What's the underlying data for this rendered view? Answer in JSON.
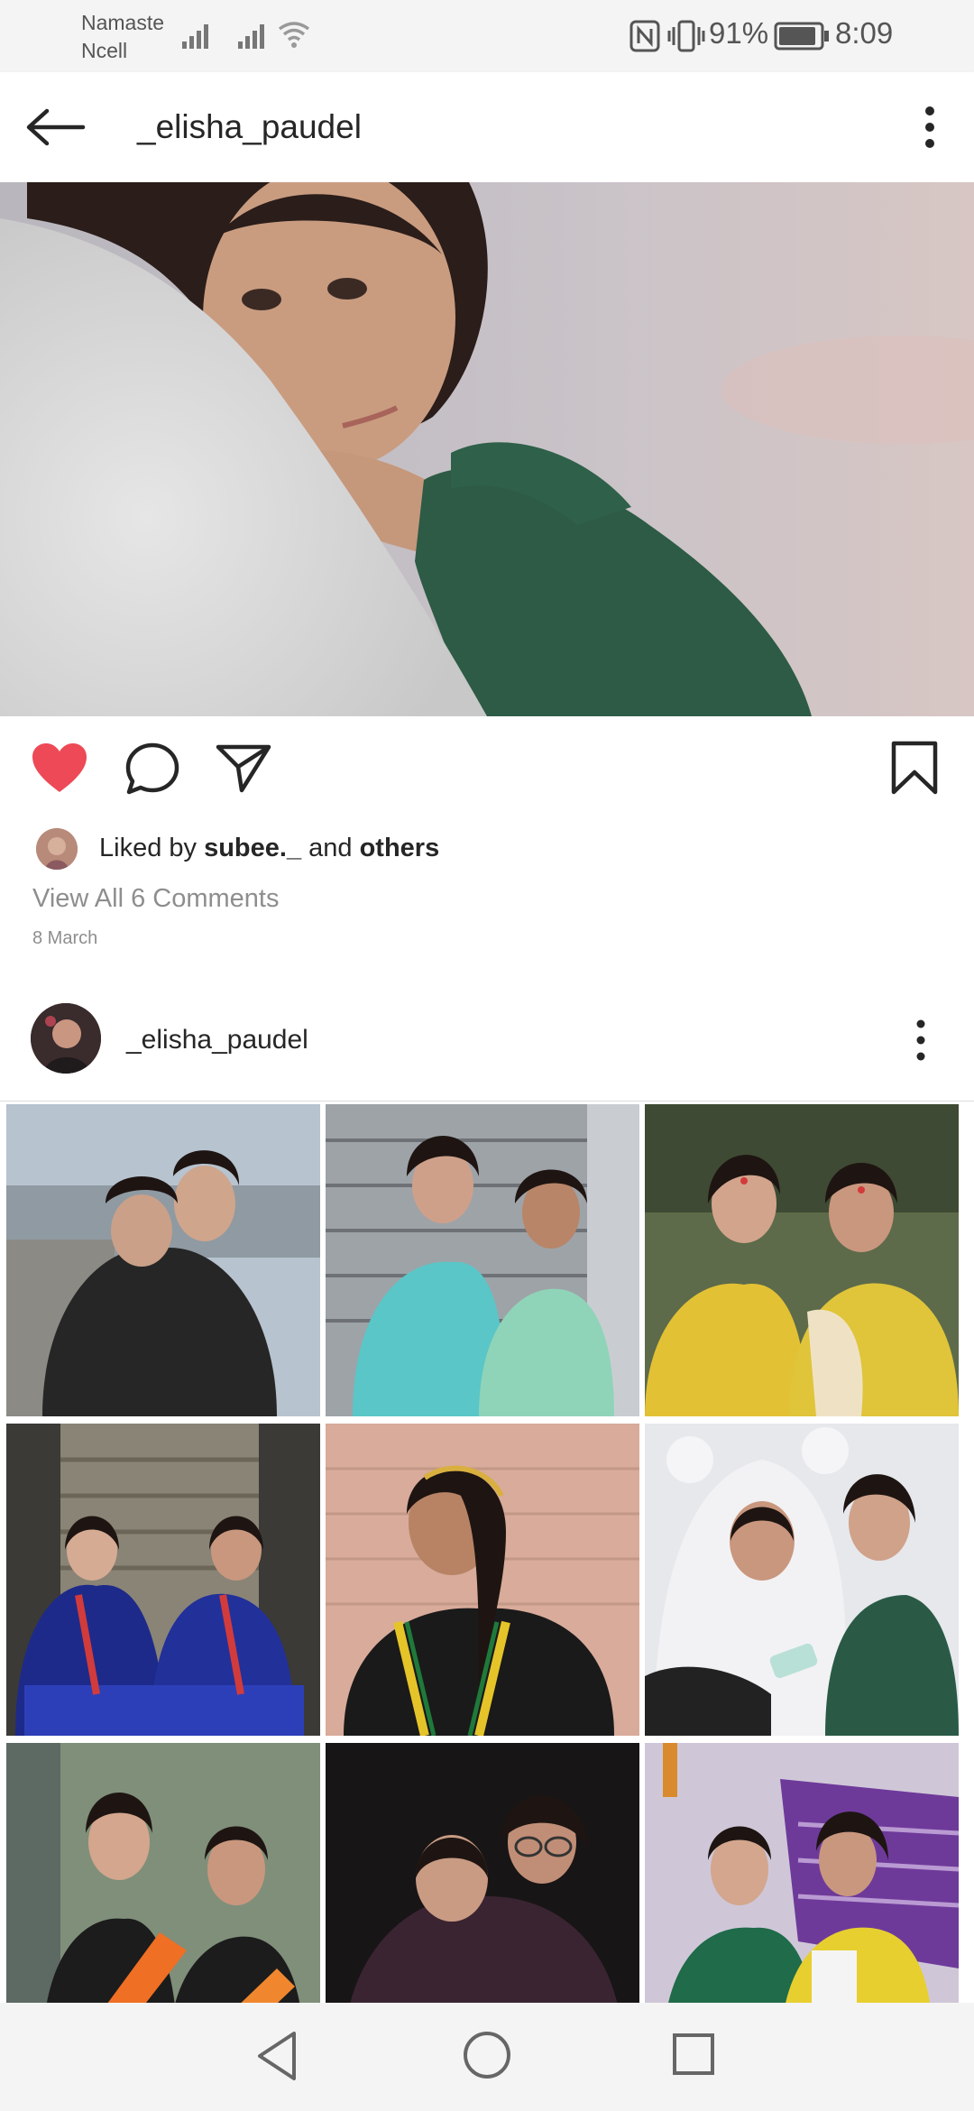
{
  "status_bar": {
    "carrier_line1": "Namaste",
    "carrier_line2": "Ncell",
    "icons": [
      "signal-icon",
      "signal-icon",
      "wifi-icon",
      "nfc-icon",
      "vibrate-icon",
      "battery-icon"
    ],
    "battery_percent": "91%",
    "battery_level": 0.91,
    "time": "8:09"
  },
  "header": {
    "title": "_elisha_paudel",
    "back_icon": "arrow-left-icon",
    "more_icon": "more-vertical-icon"
  },
  "post": {
    "actions": {
      "like_icon": "heart-filled-icon",
      "comment_icon": "comment-bubble-icon",
      "share_icon": "send-paper-plane-icon",
      "save_icon": "bookmark-icon",
      "like_color": "#ed4956"
    },
    "likes": {
      "prefix": "Liked by",
      "user": "subee._",
      "connector": "and",
      "others": "others"
    },
    "view_comments": "View All 6 Comments",
    "date": "8 March"
  },
  "profile": {
    "username": "_elisha_paudel",
    "more_icon": "more-vertical-icon"
  },
  "grid": {
    "item_count": 9
  },
  "nav_bar": {
    "icons": [
      "back-triangle-icon",
      "home-circle-icon",
      "recent-square-icon"
    ]
  },
  "colors": {
    "text_primary": "#262626",
    "text_secondary": "#8e8e8e",
    "like_red": "#ed4956"
  }
}
